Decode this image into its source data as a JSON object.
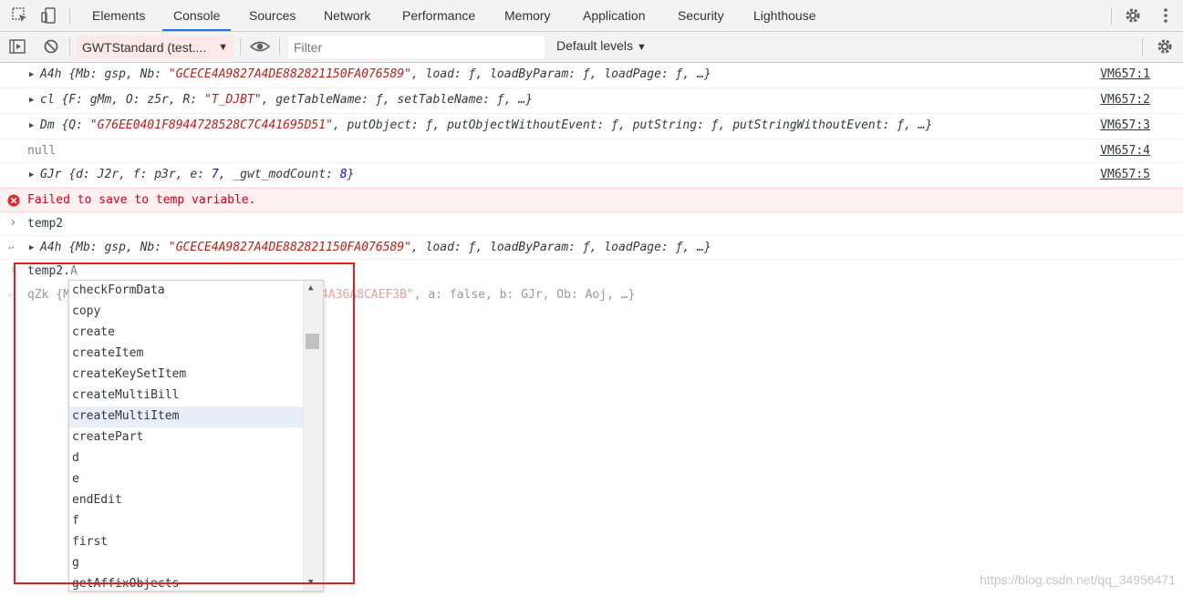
{
  "tabs": [
    {
      "label": "Elements"
    },
    {
      "label": "Console"
    },
    {
      "label": "Sources"
    },
    {
      "label": "Network"
    },
    {
      "label": "Performance"
    },
    {
      "label": "Memory"
    },
    {
      "label": "Application"
    },
    {
      "label": "Security"
    },
    {
      "label": "Lighthouse"
    }
  ],
  "active_tab": "Console",
  "toolbar": {
    "context": "GWTStandard (test....",
    "filter_placeholder": "Filter",
    "levels": "Default levels"
  },
  "rows": {
    "r1": {
      "name": "A4h",
      "mb_key": "Mb:",
      "mb_val": "gsp,",
      "nb_key": "Nb:",
      "nb_val": "\"GCECE4A9827A4DE882821150FA076589\"",
      "rest": ", load: ƒ, loadByParam: ƒ, loadPage: ƒ, …}",
      "src": "VM657:1"
    },
    "r2": {
      "name": "cl",
      "pre": "{F: gMm, O: z5r, R:",
      "r_val": "\"T_DJBT\"",
      "rest": ", getTableName: ƒ, setTableName: ƒ, …}",
      "src": "VM657:2"
    },
    "r3": {
      "name": "Dm",
      "pre": "{Q:",
      "q_val": "\"G76EE0401F8944728528C7C441695D51\"",
      "rest": ", putObject: ƒ, putObjectWithoutEvent: ƒ, putString: ƒ, putStringWithoutEvent: ƒ, …}",
      "src": "VM657:3"
    },
    "r4": {
      "text": "null",
      "src": "VM657:4"
    },
    "r5": {
      "name": "GJr",
      "pre": "{d: J2r, f: p3r, e:",
      "e_val": "7",
      "mid": ", _gwt_modCount:",
      "mod_val": "8",
      "end": "}",
      "src": "VM657:5"
    },
    "error": {
      "text": "Failed to save to temp variable."
    },
    "input1": {
      "text": "temp2"
    },
    "result1": {
      "name": "A4h",
      "pre": "{Mb: gsp, Nb:",
      "nb_val": "\"GCECE4A9827A4DE882821150FA076589\"",
      "rest": ", load: ƒ, loadByParam: ƒ, loadPage: ƒ, …}"
    },
    "input2": {
      "typed": "temp2.",
      "hint": "A"
    },
    "preview": {
      "start": "qZk {M",
      "str_tail": "4A36A8CAEF3B\"",
      "rest": ", a: false, b: GJr, Ob: Aoj, …}"
    }
  },
  "autocomplete": {
    "items": [
      "checkFormData",
      "copy",
      "create",
      "createItem",
      "createKeySetItem",
      "createMultiBill",
      "createMultiItem",
      "createPart",
      "d",
      "e",
      "endEdit",
      "f",
      "first",
      "g",
      "getAffixObjects"
    ],
    "selected": "createMultiItem"
  },
  "watermark": "https://blog.csdn.net/qq_34956471"
}
